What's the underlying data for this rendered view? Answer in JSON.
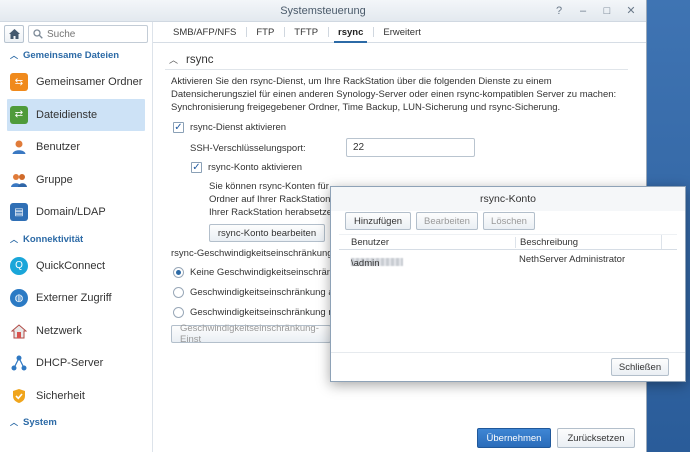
{
  "window": {
    "title": "Systemsteuerung",
    "controls": [
      "help-icon",
      "minimize-icon",
      "maximize-icon",
      "close-icon"
    ]
  },
  "sidebar": {
    "search_placeholder": "Suche",
    "sections": [
      {
        "label": "Gemeinsame Dateien",
        "items": [
          {
            "label": "Gemeinsamer Ordner",
            "icon": "shared-folder-icon",
            "color": "#f08a1c"
          },
          {
            "label": "Dateidienste",
            "icon": "file-services-icon",
            "color": "#4f9b3a",
            "active": true
          },
          {
            "label": "Benutzer",
            "icon": "user-icon",
            "color": "#e07b39"
          },
          {
            "label": "Gruppe",
            "icon": "group-icon",
            "color": "#e07b39"
          },
          {
            "label": "Domain/LDAP",
            "icon": "domain-icon",
            "color": "#2f6fb5"
          }
        ]
      },
      {
        "label": "Konnektivität",
        "items": [
          {
            "label": "QuickConnect",
            "icon": "quickconnect-icon",
            "color": "#1aa6d9"
          },
          {
            "label": "Externer Zugriff",
            "icon": "globe-icon",
            "color": "#2b7ac4"
          },
          {
            "label": "Netzwerk",
            "icon": "network-icon",
            "color": "#d9534f"
          },
          {
            "label": "DHCP-Server",
            "icon": "dhcp-icon",
            "color": "#2f78c2"
          },
          {
            "label": "Sicherheit",
            "icon": "shield-icon",
            "color": "#f0a51c"
          }
        ]
      },
      {
        "label": "System",
        "items": []
      }
    ]
  },
  "tabs": [
    {
      "label": "SMB/AFP/NFS"
    },
    {
      "label": "FTP"
    },
    {
      "label": "TFTP"
    },
    {
      "label": "rsync",
      "active": true
    },
    {
      "label": "Erweitert"
    }
  ],
  "rsync": {
    "section_title": "rsync",
    "description": "Aktivieren Sie den rsync-Dienst, um Ihre RackStation über die folgenden Dienste zu einem Datensicherungsziel für einen anderen Synology-Server oder einen rsync-kompatiblen Server zu machen: Synchronisierung freigegebener Ordner, Time Backup, LUN-Sicherung und rsync-Sicherung.",
    "enable_label": "rsync-Dienst aktivieren",
    "enable_checked": true,
    "ssh_port_label": "SSH-Verschlüsselungsport:",
    "ssh_port_value": "22",
    "account_label": "rsync-Konto aktivieren",
    "account_checked": true,
    "account_text_1": "Sie können rsync-Konten für ",
    "account_text_2": "Ordner auf Ihrer RackStation (",
    "account_text_3": "Ihrer RackStation herabsetzen",
    "edit_account_button": "rsync-Konto bearbeiten",
    "speed_limit_label": "rsync-Geschwindigkeitseinschränkunge",
    "radio_options": [
      {
        "label": "Keine Geschwindigkeitseinschränku",
        "selected": true
      },
      {
        "label": "Geschwindigkeitseinschränkung ak",
        "selected": false
      },
      {
        "label": "Geschwindigkeitseinschränkung na",
        "selected": false
      }
    ],
    "speed_settings_button": "Geschwindigkeitseinschränkung-Einst"
  },
  "footer": {
    "apply_button": "Übernehmen",
    "reset_button": "Zurücksetzen"
  },
  "dialog": {
    "title": "rsync-Konto",
    "toolbar": {
      "add": "Hinzufügen",
      "edit": "Bearbeiten",
      "delete": "Löschen"
    },
    "columns": [
      "Benutzer",
      "Beschreibung"
    ],
    "rows": [
      {
        "user": "\\admin",
        "description": "NethServer Administrator"
      }
    ],
    "close_button": "Schließen"
  }
}
